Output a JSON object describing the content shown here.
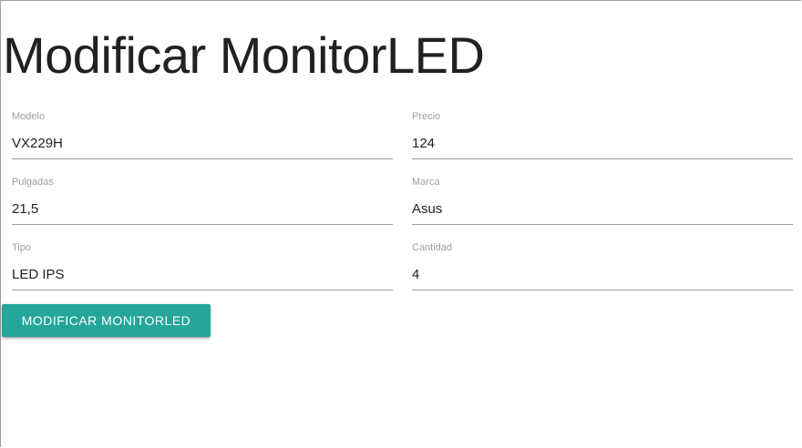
{
  "page": {
    "title": "Modificar MonitorLED"
  },
  "form": {
    "fields": [
      {
        "label": "Modelo",
        "value": "VX229H"
      },
      {
        "label": "Precio",
        "value": "124"
      },
      {
        "label": "Pulgadas",
        "value": "21,5"
      },
      {
        "label": "Marca",
        "value": "Asus"
      },
      {
        "label": "Tipo",
        "value": "LED IPS"
      },
      {
        "label": "Cantidad",
        "value": "4"
      }
    ],
    "submit_label": "MODIFICAR MONITORLED"
  },
  "colors": {
    "accent": "#26a69a",
    "label": "#9e9e9e",
    "underline": "#9e9e9e",
    "text": "#212121"
  }
}
